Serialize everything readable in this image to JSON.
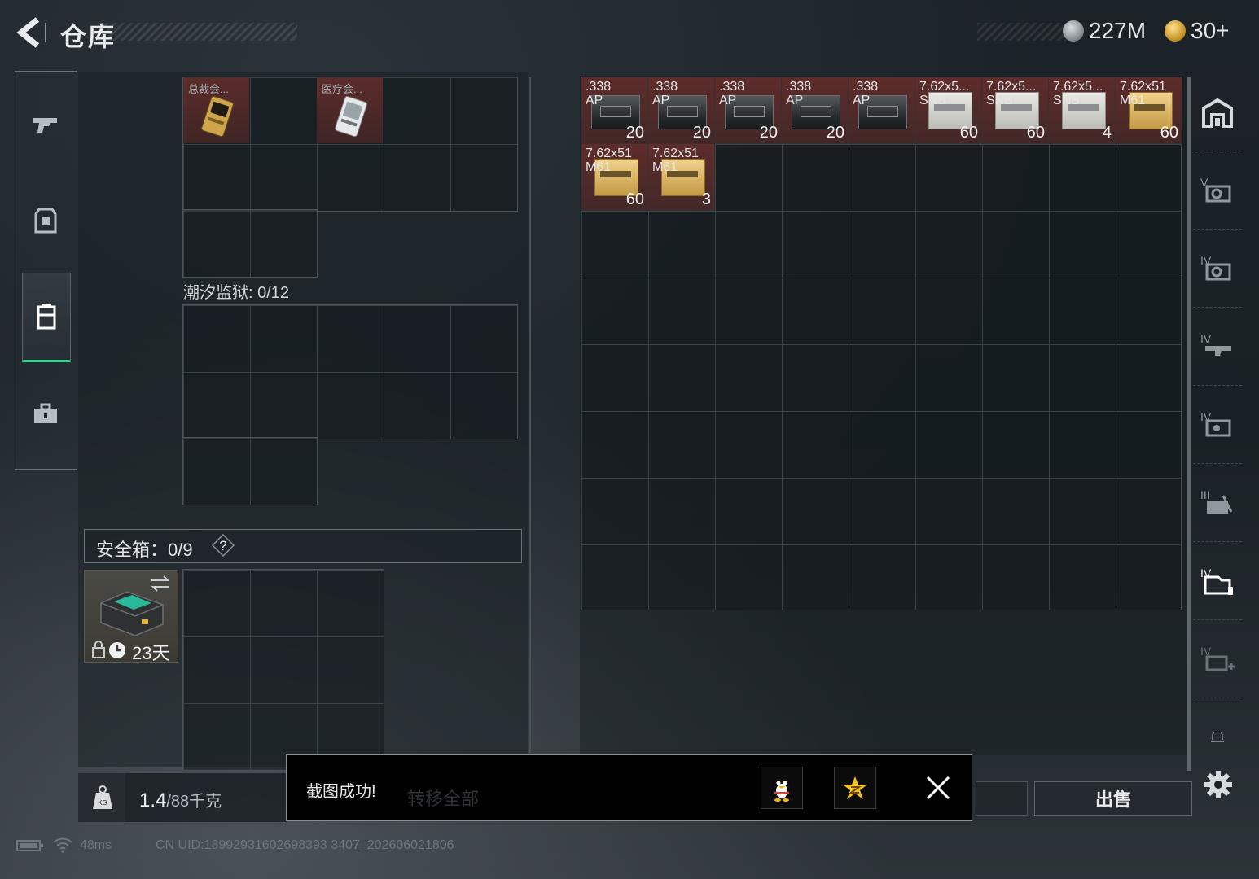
{
  "header": {
    "title": "仓库"
  },
  "currency": {
    "silver": "227M",
    "gold": "30+"
  },
  "left_panel": {
    "top_slots": [
      {
        "label": "总裁会...",
        "icon": "gold-card-icon"
      },
      {
        "label": "医疗会...",
        "icon": "medical-card-icon"
      }
    ],
    "section_label": "潮汐监狱: 0/12",
    "safebox_label": "安全箱：0/9",
    "safebox_help": "?",
    "safebox_days": "23天"
  },
  "weight": {
    "current": "1.4",
    "max": "/88千克"
  },
  "ammo_items": [
    {
      "name": ".338\nAP",
      "count": "20",
      "box": "dark"
    },
    {
      "name": ".338\nAP",
      "count": "20",
      "box": "dark"
    },
    {
      "name": ".338\nAP",
      "count": "20",
      "box": "dark"
    },
    {
      "name": ".338\nAP",
      "count": "20",
      "box": "dark"
    },
    {
      "name": ".338\nAP",
      "count": "",
      "box": "dark"
    },
    {
      "name": "7.62x5...\nSNB",
      "count": "60",
      "box": "white"
    },
    {
      "name": "7.62x5...\nSNB",
      "count": "60",
      "box": "white"
    },
    {
      "name": "7.62x5...\nSNB",
      "count": "4",
      "box": "white"
    },
    {
      "name": "7.62x51\nM61",
      "count": "60",
      "box": "gold"
    },
    {
      "name": "7.62x51\nM61",
      "count": "60",
      "box": "gold"
    },
    {
      "name": "7.62x51\nM61",
      "count": "3",
      "box": "gold"
    }
  ],
  "filters": [
    {
      "name": "all-icon"
    },
    {
      "name": "v-armor-icon",
      "tier": "V"
    },
    {
      "name": "iv-armor-icon",
      "tier": "IV"
    },
    {
      "name": "iv-weapon-icon",
      "tier": "IV"
    },
    {
      "name": "iv-gear-icon",
      "tier": "IV"
    },
    {
      "name": "iii-tools-icon",
      "tier": "III"
    },
    {
      "name": "iv-container-icon",
      "tier": "IV"
    },
    {
      "name": "iv-medical-icon",
      "tier": "IV"
    }
  ],
  "buttons": {
    "sell": "出售"
  },
  "toast": {
    "message": "截图成功!",
    "bg_label": "转移全部"
  },
  "status": {
    "ping": "48ms",
    "uid": "CN UID:18992931602698393 3407_202606021806"
  },
  "colors": {
    "accent_green": "#2bd48a",
    "item_red": "#5b2c2a",
    "gold": "#f3c24a"
  }
}
